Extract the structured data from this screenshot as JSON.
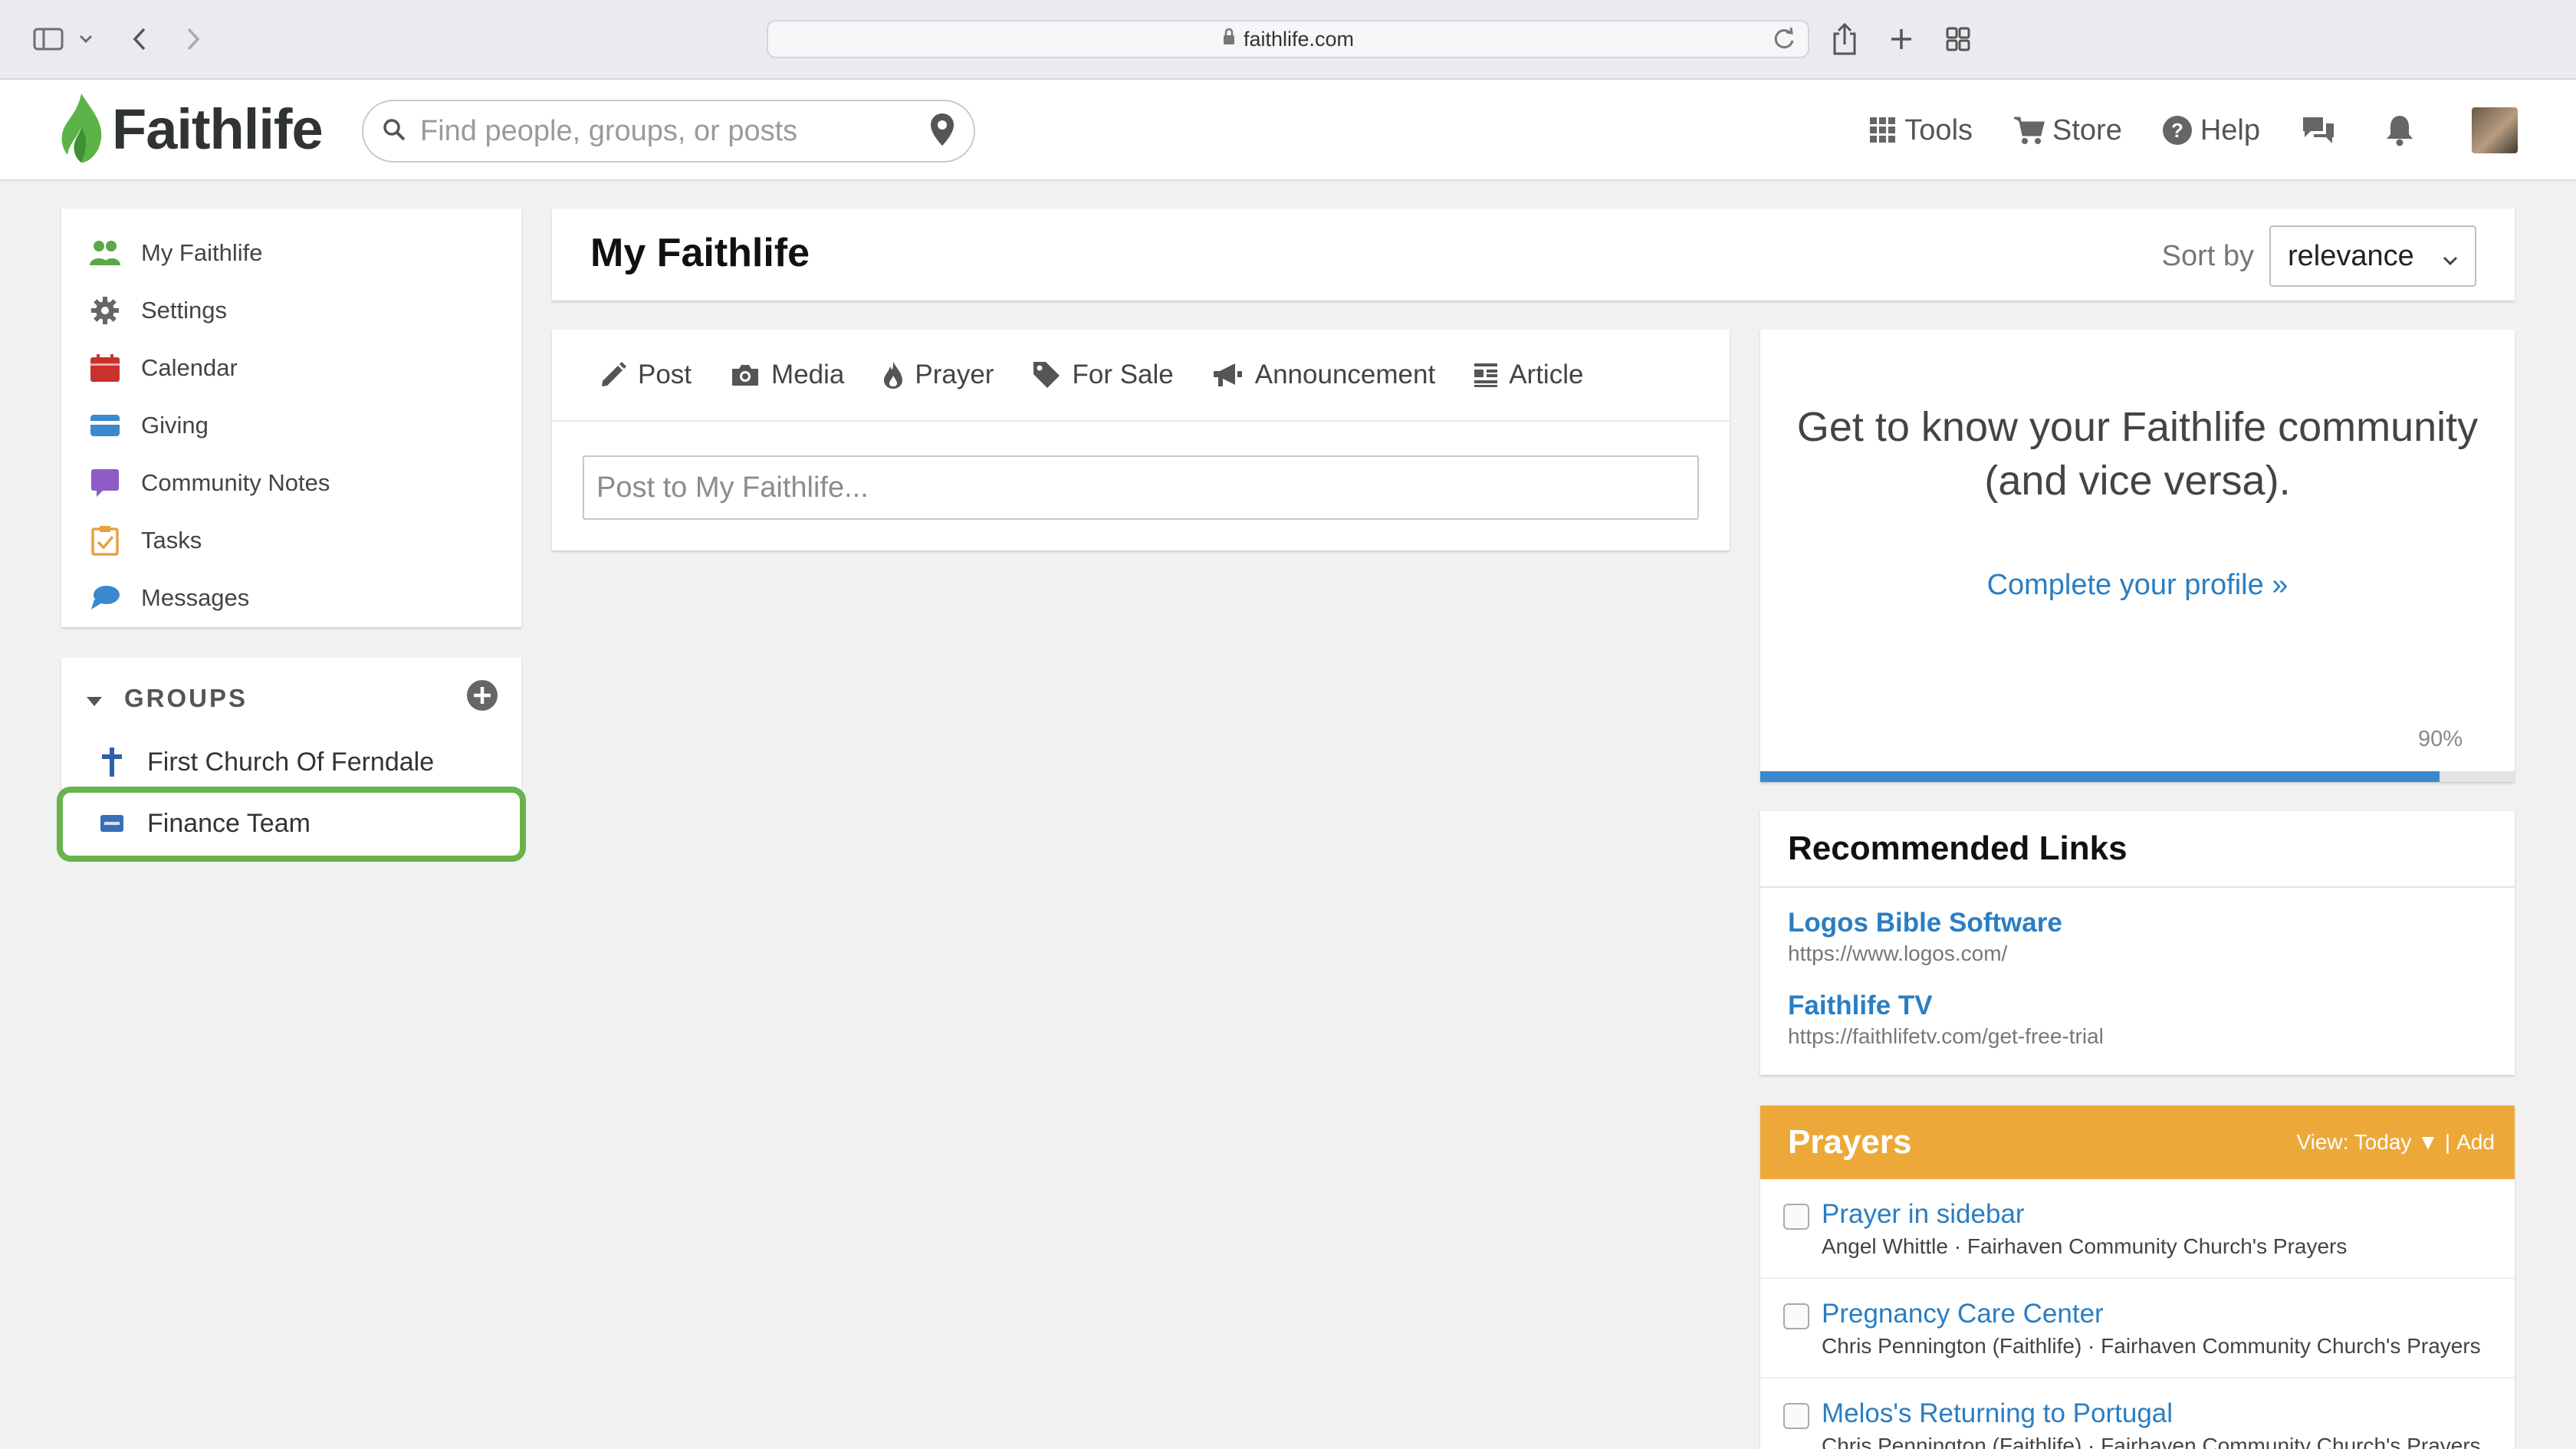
{
  "browser": {
    "url": "faithlife.com"
  },
  "nav": {
    "logo_text": "Faithlife",
    "search_placeholder": "Find people, groups, or posts",
    "links": [
      {
        "label": "Tools",
        "icon": "grid-icon"
      },
      {
        "label": "Store",
        "icon": "cart-icon"
      },
      {
        "label": "Help",
        "icon": "help-icon"
      }
    ]
  },
  "sidebar": {
    "items": [
      {
        "label": "My Faithlife",
        "icon": "people-icon",
        "color": "#5aa84a"
      },
      {
        "label": "Settings",
        "icon": "gear-icon",
        "color": "#666666"
      },
      {
        "label": "Calendar",
        "icon": "calendar-icon",
        "color": "#c8312e"
      },
      {
        "label": "Giving",
        "icon": "card-icon",
        "color": "#3a88cd"
      },
      {
        "label": "Community Notes",
        "icon": "note-icon",
        "color": "#8e5cc4"
      },
      {
        "label": "Tasks",
        "icon": "clipboard-icon",
        "color": "#e8a040"
      },
      {
        "label": "Messages",
        "icon": "chat-icon",
        "color": "#3a88cd"
      }
    ]
  },
  "groups": {
    "heading": "GROUPS",
    "items": [
      {
        "label": "First Church Of Ferndale",
        "icon": "cross-icon"
      },
      {
        "label": "Finance Team",
        "icon": "card-icon"
      }
    ]
  },
  "main": {
    "title": "My Faithlife",
    "sort_label": "Sort by",
    "sort_value": "relevance",
    "composer_tabs": [
      {
        "label": "Post",
        "icon": "pencil-icon"
      },
      {
        "label": "Media",
        "icon": "camera-icon"
      },
      {
        "label": "Prayer",
        "icon": "flame-icon"
      },
      {
        "label": "For Sale",
        "icon": "tag-icon"
      },
      {
        "label": "Announcement",
        "icon": "megaphone-icon"
      },
      {
        "label": "Article",
        "icon": "article-icon"
      }
    ],
    "post_placeholder": "Post to My Faithlife..."
  },
  "profile": {
    "headline": "Get to know your Faithlife community (and vice versa).",
    "link": "Complete your profile »",
    "progress_label": "90%",
    "progress": 0.9
  },
  "recommended": {
    "title": "Recommended Links",
    "links": [
      {
        "title": "Logos Bible Software",
        "url": "https://www.logos.com/"
      },
      {
        "title": "Faithlife TV",
        "url": "https://faithlifetv.com/get-free-trial"
      }
    ]
  },
  "prayers": {
    "title": "Prayers",
    "view_label": "View: Today ▼",
    "sep": "|",
    "add_label": "Add",
    "items": [
      {
        "title": "Prayer in sidebar",
        "sub": "Angel Whittle · Fairhaven Community Church's Prayers"
      },
      {
        "title": "Pregnancy Care Center",
        "sub": "Chris Pennington (Faithlife) · Fairhaven Community Church's Prayers"
      },
      {
        "title": "Melos's Returning to Portugal",
        "sub": "Chris Pennington (Faithlife) · Fairhaven Community Church's Prayers"
      }
    ]
  },
  "colors": {
    "accent_green": "#69b34c",
    "link_blue": "#2a7ec2",
    "prayers_orange": "#eca93a"
  }
}
